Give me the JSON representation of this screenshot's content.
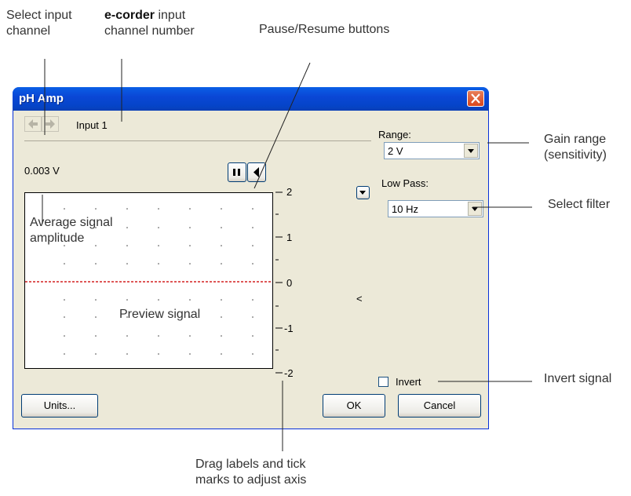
{
  "annotations": {
    "select_channel": [
      "Select input",
      "channel"
    ],
    "channel_number_bold": "e-corder",
    "channel_number_rest": " input",
    "channel_number_line2": "channel number",
    "pause_resume": "Pause/Resume buttons",
    "gain_range": [
      "Gain range",
      "(sensitivity)"
    ],
    "select_filter": "Select filter",
    "invert_signal": "Invert signal",
    "drag_labels": [
      "Drag labels and tick",
      "marks to adjust axis"
    ],
    "average_signal": [
      "Average signal",
      "amplitude"
    ],
    "preview_signal": "Preview signal"
  },
  "window": {
    "title": "pH Amp",
    "input_label": "Input 1",
    "reading": "0.003 V",
    "range": {
      "label": "Range:",
      "value": "2 V"
    },
    "low_pass": {
      "label": "Low Pass:",
      "value": "10 Hz"
    },
    "invert_label": "Invert",
    "invert_checked": false,
    "collapse_label": "<",
    "units_button": "Units...",
    "ok_button": "OK",
    "cancel_button": "Cancel",
    "axis_ticks": [
      "2",
      "1",
      "0",
      "-1",
      "-2"
    ],
    "colors": {
      "zero_line": "#d42020",
      "title_bar": "#0a47d6",
      "close_button": "#d8461c"
    }
  }
}
